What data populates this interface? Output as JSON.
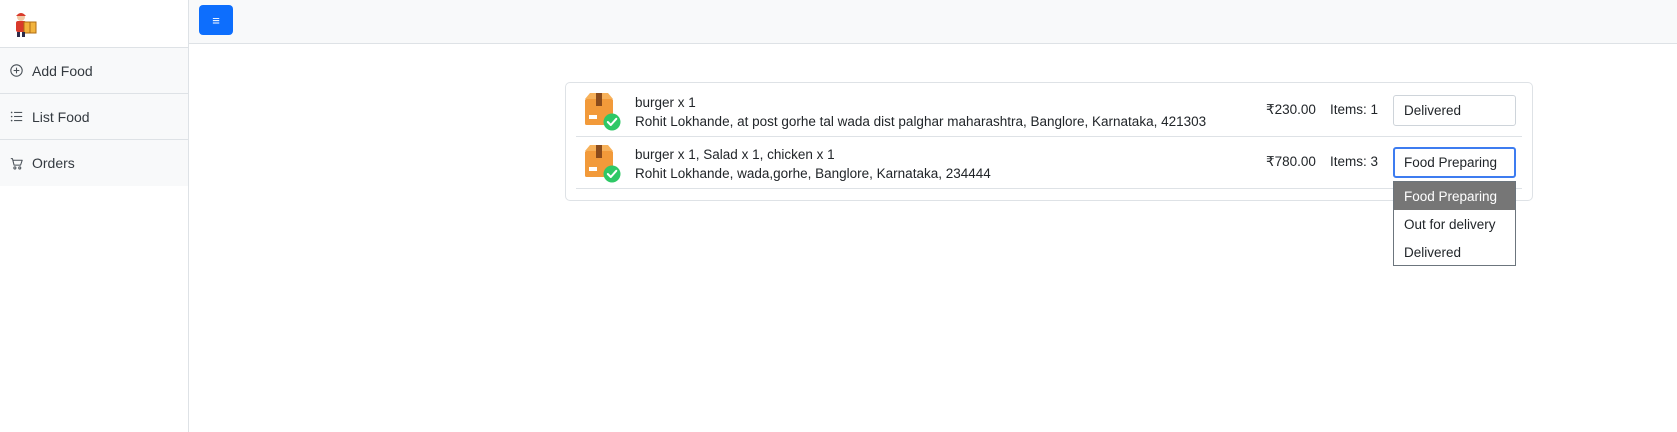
{
  "sidebar": {
    "items": [
      {
        "label": "Add Food",
        "icon": "plus-circle-icon"
      },
      {
        "label": "List Food",
        "icon": "list-icon"
      },
      {
        "label": "Orders",
        "icon": "cart-icon"
      }
    ]
  },
  "topbar": {
    "menu_icon": "≡"
  },
  "orders": [
    {
      "items_text": "burger x 1",
      "address": "Rohit Lokhande, at post gorhe tal wada dist palghar maharashtra, Banglore, Karnataka, 421303",
      "amount": "₹230.00",
      "items_count": "Items: 1",
      "status": "Delivered"
    },
    {
      "items_text": "burger x 1, Salad x 1, chicken x 1",
      "address": "Rohit Lokhande, wada,gorhe, Banglore, Karnataka, 234444",
      "amount": "₹780.00",
      "items_count": "Items: 3",
      "status": "Food Preparing"
    }
  ],
  "status_dropdown": {
    "options": [
      "Food Preparing",
      "Out for delivery",
      "Delivered"
    ],
    "selected": "Food Preparing"
  },
  "colors": {
    "primary": "#0d6efd",
    "parcel_orange": "#f29a3a",
    "check_green": "#2ec866",
    "selected_option_bg": "#767676"
  }
}
